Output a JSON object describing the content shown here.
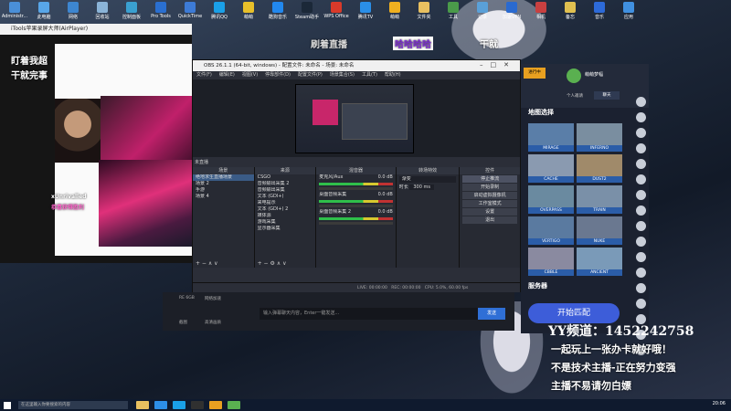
{
  "desktop": {
    "icons": [
      {
        "label": "Administr...",
        "color": "#4a8fd8"
      },
      {
        "label": "此电脑",
        "color": "#58a6e8"
      },
      {
        "label": "网络",
        "color": "#3d86d0"
      },
      {
        "label": "回收站",
        "color": "#8bb4d8"
      },
      {
        "label": "控制面板",
        "color": "#3aa0d0"
      },
      {
        "label": "Pro Tools",
        "color": "#2a6fd0"
      },
      {
        "label": "QuickTime",
        "color": "#3d7bd6"
      },
      {
        "label": "腾讯QQ",
        "color": "#1aa0e8"
      },
      {
        "label": "萌萌",
        "color": "#e8c02a"
      },
      {
        "label": "酷狗音乐",
        "color": "#2288ee"
      },
      {
        "label": "Steam助手",
        "color": "#1b2838"
      },
      {
        "label": "WPS Office",
        "color": "#d83a2a"
      },
      {
        "label": "腾讯TV",
        "color": "#2a8fe8"
      },
      {
        "label": "萌萌",
        "color": "#f0b020"
      },
      {
        "label": "文件夹",
        "color": "#e8c060"
      },
      {
        "label": "工具",
        "color": "#4a9a4a"
      },
      {
        "label": "记录",
        "color": "#5aa0d8"
      },
      {
        "label": "加速VPN",
        "color": "#2a6ad0"
      },
      {
        "label": "相机",
        "color": "#c84040"
      },
      {
        "label": "备忘",
        "color": "#e0c050"
      },
      {
        "label": "音乐",
        "color": "#2d6ad8"
      },
      {
        "label": "应用",
        "color": "#4090e0"
      }
    ]
  },
  "airplayer": {
    "title": "iTools苹果录屏大师(AirPlayer)"
  },
  "overlay": {
    "left_line1": "盯着我超",
    "left_line2": "干就完事",
    "top_text1": "刷着直播",
    "top_text2": "哈哈哈哈",
    "top_text3": "干就",
    "username": "xUnrivalled",
    "sub": "恭喜获得胜利"
  },
  "obs": {
    "title": "OBS 26.1.1 (64-bit, windows) - 配置文件: 未命名 - 场景: 未命名",
    "menu": [
      "文件(F)",
      "编辑(E)",
      "视图(V)",
      "停靠部件(D)",
      "配置文件(P)",
      "场景集合(S)",
      "工具(T)",
      "帮助(H)"
    ],
    "not_live": "未直播",
    "panels": {
      "scenes": {
        "header": "场景",
        "items": [
          "绝地求生直播场景",
          "场景 2",
          "手游",
          "场景 4"
        ]
      },
      "sources": {
        "header": "来源",
        "items": [
          "CSGO",
          "音频输出采集 2",
          "音频输出采集",
          "文本 (GDI+)",
          "来电提示",
          "文本 (GDI+) 2",
          "媒体源",
          "游戏采集",
          "显示器采集"
        ]
      },
      "mixer": {
        "header": "混音器",
        "channels": [
          {
            "name": "麦克风/Aux",
            "db": "0.0 dB"
          },
          {
            "name": "桌面音频采集",
            "db": "0.0 dB"
          },
          {
            "name": "桌面音频采集 2",
            "db": "0.0 dB"
          }
        ]
      },
      "transitions": {
        "header": "转场特效",
        "type": "渐变",
        "duration_label": "时长",
        "duration": "300 ms"
      },
      "controls": {
        "header": "控件",
        "buttons": [
          "停止推流",
          "开始录制",
          "启动虚拟摄像机",
          "工作室模式",
          "设置",
          "退出"
        ]
      }
    },
    "status": {
      "live": "LIVE: 00:00:00",
      "rec": "REC: 00:00:00",
      "cpu": "CPU: 5.0%, 60.00 fps"
    }
  },
  "chat": {
    "placeholder": "输入弹幕聊天内容，Enter一键发送...",
    "send": "发送",
    "left1": "RE 6GB",
    "left2": "网络加速",
    "left3": "截图",
    "left4": "高清画质"
  },
  "csgo": {
    "user": "萌萌梦幅",
    "live_badge": "进行中",
    "map_section": "地图选择",
    "server_section": "服务器",
    "maps": [
      "MIRAGE",
      "INFERNO",
      "CACHE",
      "DUST2",
      "OVERPASS",
      "TRAIN",
      "VERTIGO",
      "NUKE",
      "CBBLE",
      "ANCIENT"
    ],
    "start_button": "开始匹配",
    "invite": "个人邀请",
    "chat": "聊天"
  },
  "promo": {
    "yy": "YY频道：1452242758",
    "line1": "一起玩上一张办卡就好哦！",
    "line2": "不是技术主播-正在努力变强",
    "line3": "主播不易请勿白嫖"
  },
  "taskbar": {
    "search": "在这里输入你要搜索的内容",
    "time": "20:06"
  }
}
